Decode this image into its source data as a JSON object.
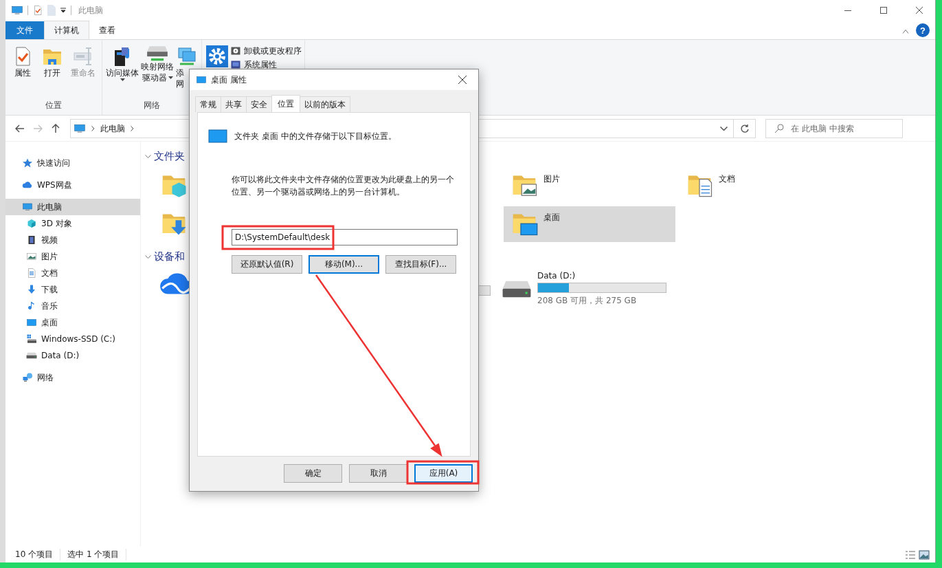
{
  "window": {
    "title": "此电脑",
    "help_button": "?"
  },
  "ribbon": {
    "tabs": [
      {
        "label": "文件",
        "kind": "file",
        "selected": false
      },
      {
        "label": "计算机",
        "kind": "tab",
        "selected": true
      },
      {
        "label": "查看",
        "kind": "tab",
        "selected": false
      }
    ],
    "groups": [
      {
        "label": "位置",
        "commands": [
          {
            "lines": [
              "属性"
            ],
            "disabled": false,
            "dropdown": false
          },
          {
            "lines": [
              "打开"
            ],
            "disabled": false,
            "dropdown": false
          },
          {
            "lines": [
              "重命名"
            ],
            "disabled": true,
            "dropdown": false
          }
        ]
      },
      {
        "label": "网络",
        "commands": [
          {
            "lines": [
              "访问媒体"
            ],
            "disabled": false,
            "dropdown": true
          },
          {
            "lines": [
              "映射网络",
              "驱动器"
            ],
            "disabled": false,
            "dropdown": true
          },
          {
            "lines": [
              "添",
              "网"
            ],
            "disabled": false,
            "dropdown": false
          }
        ]
      },
      {
        "commands": [
          {
            "disabled": false
          }
        ],
        "small_commands": [
          {
            "label": "卸载或更改程序"
          },
          {
            "label": "系统属性"
          }
        ]
      }
    ]
  },
  "address": {
    "nav_buttons": [
      {
        "kind": "back",
        "disabled": false
      },
      {
        "kind": "forward",
        "disabled": true
      },
      {
        "kind": "up",
        "disabled": false
      }
    ],
    "path": [
      "此电脑"
    ],
    "search_placeholder": "在 此电脑 中搜索"
  },
  "sidebar": {
    "items": [
      {
        "label": "快速访问",
        "selected": false
      },
      {
        "label": "WPS网盘",
        "selected": false
      },
      {
        "label": "此电脑",
        "selected": true,
        "children": [
          {
            "label": "3D 对象",
            "selected": false
          },
          {
            "label": "视频",
            "selected": false
          },
          {
            "label": "图片",
            "selected": false
          },
          {
            "label": "文档",
            "selected": false
          },
          {
            "label": "下载",
            "selected": false
          },
          {
            "label": "音乐",
            "selected": false
          },
          {
            "label": "桌面",
            "selected": false
          },
          {
            "label": "Windows-SSD (C:)",
            "selected": false
          },
          {
            "label": "Data (D:)",
            "selected": false
          }
        ]
      },
      {
        "label": "网络",
        "selected": false
      }
    ]
  },
  "content": {
    "groups": [
      {
        "title": "文件夹",
        "expanded": true,
        "tiles": [
          {
            "kind": "folder",
            "selected": false
          },
          {
            "kind": "folder",
            "label": "图片",
            "selected": false
          },
          {
            "kind": "folder",
            "label": "文档",
            "selected": false
          },
          {
            "kind": "folder",
            "selected": false
          },
          {
            "kind": "folder",
            "label": "桌面",
            "selected": true
          }
        ]
      },
      {
        "title": "设备和",
        "expanded": true,
        "tiles": [
          {
            "kind": "cloud"
          },
          {
            "kind": "bar"
          },
          {
            "kind": "drive",
            "label": "Data (D:)",
            "level": 0.24,
            "detail": "208 GB 可用，共 275 GB",
            "selected": false
          }
        ]
      }
    ]
  },
  "status_bar": {
    "items": [
      "10 个项目",
      "选中 1 个项目"
    ]
  },
  "dialog": {
    "title": "桌面 属性",
    "tabs": [
      {
        "label": "常规",
        "selected": false
      },
      {
        "label": "共享",
        "selected": false
      },
      {
        "label": "安全",
        "selected": false
      },
      {
        "label": "位置",
        "selected": true
      },
      {
        "label": "以前的版本",
        "selected": false
      }
    ],
    "heading": "文件夹 桌面 中的文件存储于以下目标位置。",
    "description": "你可以将此文件夹中文件存储的位置更改为此硬盘上的另一个位置、另一个驱动器或网络上的另一台计算机。",
    "path_value": "D:\\SystemDefault\\desk",
    "path_buttons": [
      {
        "label": "还原默认值(R)",
        "focused": false
      },
      {
        "label": "移动(M)...",
        "focused": true
      },
      {
        "label": "查找目标(F)...",
        "focused": false
      }
    ],
    "footer_buttons": [
      {
        "label": "确定",
        "focused": false
      },
      {
        "label": "取消",
        "focused": false
      },
      {
        "label": "应用(A)",
        "focused": true
      }
    ]
  }
}
